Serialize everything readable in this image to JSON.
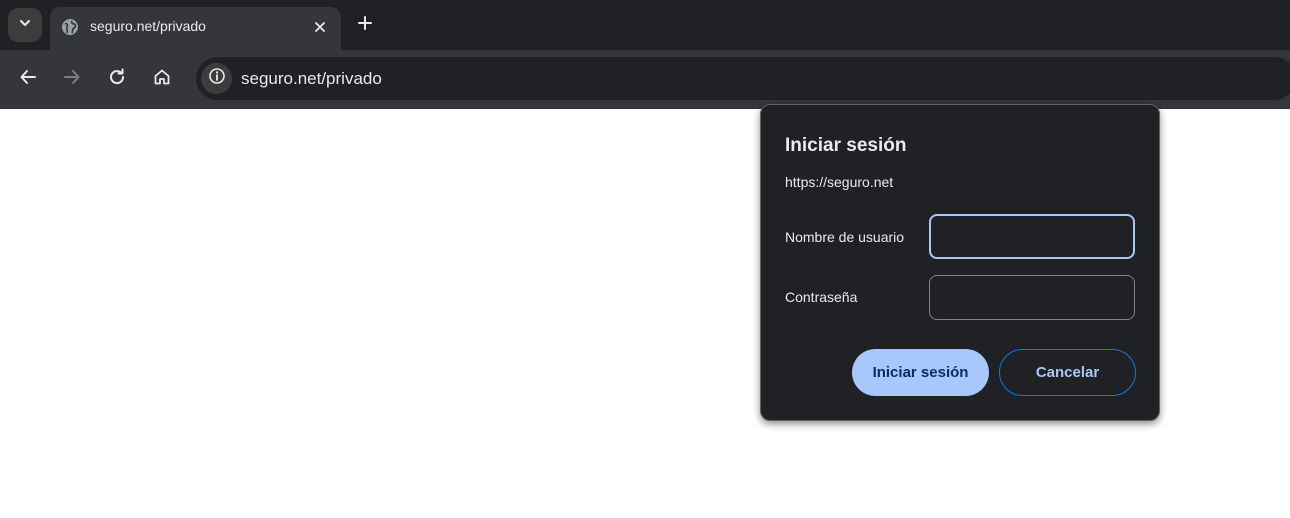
{
  "tabstrip": {
    "tab": {
      "title": "seguro.net/privado"
    }
  },
  "toolbar": {
    "url": "seguro.net/privado"
  },
  "dialog": {
    "title": "Iniciar sesión",
    "origin": "https://seguro.net",
    "username": {
      "label": "Nombre de usuario",
      "value": ""
    },
    "password": {
      "label": "Contraseña",
      "value": ""
    },
    "submit_label": "Iniciar sesión",
    "cancel_label": "Cancelar"
  },
  "icons": {
    "tab_search": "chevron-down-icon",
    "favicon": "globe-icon",
    "tab_close": "close-icon",
    "new_tab": "plus-icon",
    "back": "arrow-left-icon",
    "forward": "arrow-right-icon",
    "reload": "reload-icon",
    "home": "home-icon",
    "site_info": "info-icon"
  },
  "colors": {
    "tabstrip_bg": "#202124",
    "toolbar_bg": "#35363a",
    "dialog_bg": "#202124",
    "accent": "#a8c7fa",
    "primary_text_on_accent": "#062e6f"
  }
}
